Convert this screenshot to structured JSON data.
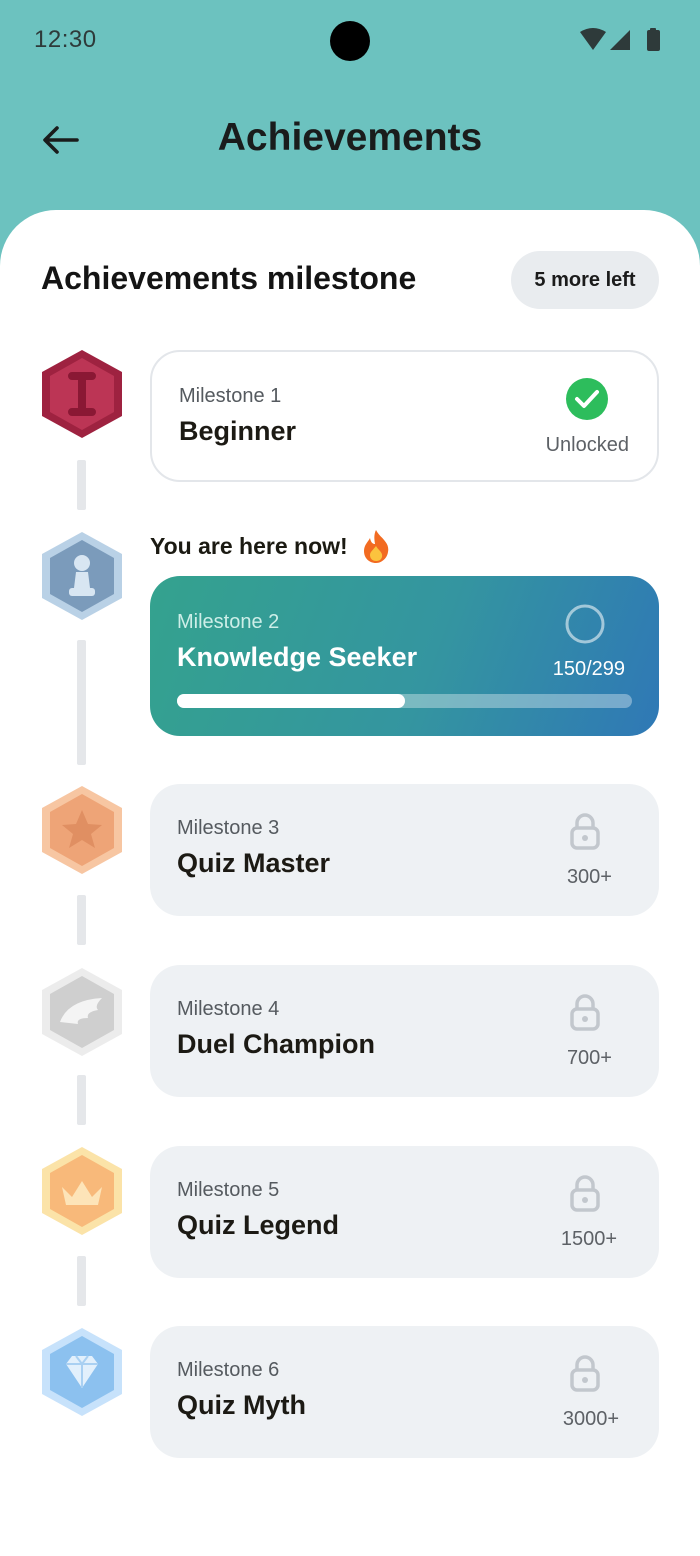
{
  "status_bar": {
    "time": "12:30",
    "icons": [
      "wifi-icon",
      "signal-icon",
      "battery-icon"
    ]
  },
  "header": {
    "back_icon": "arrow-left-icon",
    "title": "Achievements"
  },
  "section": {
    "title": "Achievements milestone",
    "remaining_label": "5 more left"
  },
  "current_marker": {
    "label": "You are here now!",
    "icon": "fire-icon"
  },
  "colors": {
    "header_bg": "#6cc2bf",
    "unlocked_green": "#2dbd5c",
    "current_gradient_start": "#34a28e",
    "current_gradient_end": "#2f78b6",
    "locked_card_bg": "#eef1f4"
  },
  "milestones": [
    {
      "kicker": "Milestone 1",
      "name": "Beginner",
      "status": "Unlocked",
      "state": "unlocked",
      "badge_icon": "roman-one-badge-icon",
      "status_icon": "check-circle-icon"
    },
    {
      "kicker": "Milestone 2",
      "name": "Knowledge Seeker",
      "status": "150/299",
      "state": "current",
      "progress": 0.5,
      "badge_icon": "pawn-badge-icon",
      "status_icon": "empty-circle-icon"
    },
    {
      "kicker": "Milestone 3",
      "name": "Quiz Master",
      "status": "300+",
      "state": "locked",
      "badge_icon": "star-badge-icon",
      "status_icon": "lock-icon"
    },
    {
      "kicker": "Milestone 4",
      "name": "Duel Champion",
      "status": "700+",
      "state": "locked",
      "badge_icon": "wing-badge-icon",
      "status_icon": "lock-icon"
    },
    {
      "kicker": "Milestone 5",
      "name": "Quiz Legend",
      "status": "1500+",
      "state": "locked",
      "badge_icon": "crown-badge-icon",
      "status_icon": "lock-icon"
    },
    {
      "kicker": "Milestone 6",
      "name": "Quiz Myth",
      "status": "3000+",
      "state": "locked",
      "badge_icon": "diamond-badge-icon",
      "status_icon": "lock-icon"
    }
  ]
}
